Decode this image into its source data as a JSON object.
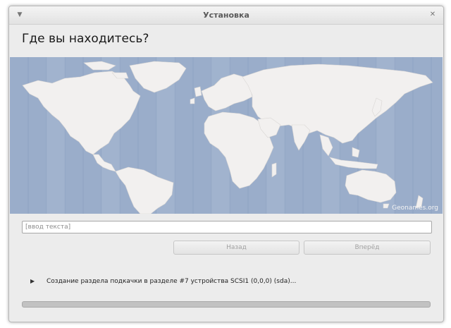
{
  "window": {
    "title": "Установка"
  },
  "page": {
    "heading": "Где вы находитесь?"
  },
  "map": {
    "credit": "Geonames.org",
    "ocean_color": "#9aadca",
    "land_color": "#f2f0ef"
  },
  "search": {
    "placeholder": "[ввод текста]"
  },
  "buttons": {
    "back_label": "Назад",
    "next_label": "Вперёд"
  },
  "progress": {
    "label": "Создание раздела подкачки в разделе #7 устройства SCSI1 (0,0,0) (sda)...",
    "fraction": 0.0
  },
  "icons": {
    "menu": "chevron-down-icon",
    "close": "close-icon",
    "expand": "play-triangle-icon"
  }
}
